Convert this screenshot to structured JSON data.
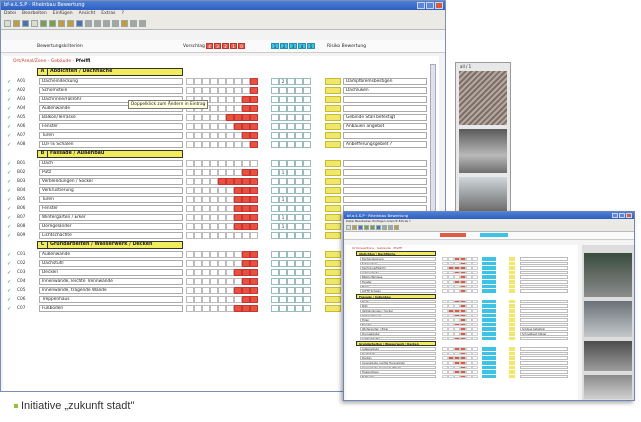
{
  "window": {
    "title": "bf-a.Ł.S.P · Rheinbau Bewertung",
    "menu": [
      "Datei",
      "Bearbeiten",
      "Einfügen",
      "Ansicht",
      "Extras",
      "?"
    ]
  },
  "scale": {
    "left_label": "Bewertungskriterien",
    "mid_label": "Vorschlag",
    "red_values": [
      "4",
      "3",
      "2",
      "1",
      "0"
    ],
    "blue_values": [
      "1",
      "2",
      "3",
      "4",
      "5"
    ],
    "right_label": "Risiko Bewertung"
  },
  "grid": {
    "breadcrumb_pre": "Ort/Areal/Zone - Gebäude - ",
    "breadcrumb_cur": "Pfeiffl",
    "tooltip": "Doppelklick zum Ändern in Eintrag",
    "photo_label": "all / 1"
  },
  "sections": [
    {
      "num": "A",
      "title": "Abdichten / Dachfläche",
      "rows": [
        {
          "code": "A01",
          "name": "Dacheindeckung",
          "red": [
            5
          ],
          "blue": "2",
          "note": "Dampfbremsbestigen"
        },
        {
          "code": "A02",
          "name": "Schornstein",
          "red": [
            5
          ],
          "blue": "",
          "note": "Dachluken"
        },
        {
          "code": "A03",
          "name": "Dachrinne/Fallrohr",
          "red": [
            4,
            5
          ],
          "blue": "",
          "note": ""
        },
        {
          "code": "A04",
          "name": "Außenwände",
          "red": [
            4,
            5
          ],
          "blue": "",
          "note": ""
        },
        {
          "code": "A05",
          "name": "Balkon/Terrasse",
          "red": [
            2,
            3,
            4,
            5
          ],
          "blue": "",
          "note": "Gebinde Stall befestigt"
        },
        {
          "code": "A06",
          "name": "Fenster",
          "red": [
            3,
            4,
            5
          ],
          "blue": "",
          "note": "Anbauen angebot"
        },
        {
          "code": "A07",
          "name": "Türen",
          "red": [
            4,
            5
          ],
          "blue": "",
          "note": ""
        },
        {
          "code": "A08",
          "name": "LÜFTE Schalen",
          "red": [
            5
          ],
          "blue": "",
          "note": "Anbefferungsgebiet ?"
        }
      ]
    },
    {
      "num": "B",
      "title": "Fassade / Außenbau",
      "rows": [
        {
          "code": "B01",
          "name": "Dach",
          "red": [],
          "blue": "",
          "note": ""
        },
        {
          "code": "B02",
          "name": "Putz",
          "red": [
            4,
            5
          ],
          "blue": "1",
          "note": ""
        },
        {
          "code": "B03",
          "name": "Verblendungen / Sockel",
          "red": [
            1,
            2,
            3,
            4,
            5
          ],
          "blue": "",
          "note": ""
        },
        {
          "code": "B04",
          "name": "Verkrustierung",
          "red": [
            3,
            4,
            5
          ],
          "blue": "",
          "note": ""
        },
        {
          "code": "B05",
          "name": "Türen",
          "red": [
            3,
            4,
            5
          ],
          "blue": "1",
          "note": ""
        },
        {
          "code": "B06",
          "name": "Fenster",
          "red": [
            3,
            4,
            5
          ],
          "blue": "",
          "note": ""
        },
        {
          "code": "B07",
          "name": "Wintergarten / Erker",
          "red": [
            3,
            4,
            5
          ],
          "blue": "1",
          "note": ""
        },
        {
          "code": "B08",
          "name": "Dorngeländer",
          "red": [
            3,
            4,
            5
          ],
          "blue": "1",
          "note": ""
        },
        {
          "code": "B09",
          "name": "Lichtschächte",
          "red": [],
          "blue": "",
          "note": ""
        }
      ]
    },
    {
      "num": "C",
      "title": "Grundarbeiten / Wasserwerk / Decken",
      "rows": [
        {
          "code": "C01",
          "name": "Außenwände",
          "red": [
            4,
            5
          ],
          "blue": "",
          "note": ""
        },
        {
          "code": "C02",
          "name": "Dachstuhl",
          "red": [
            4,
            5
          ],
          "blue": "",
          "note": ""
        },
        {
          "code": "C03",
          "name": "Decken",
          "red": [
            3,
            4,
            5
          ],
          "blue": "",
          "note": ""
        },
        {
          "code": "C04",
          "name": "Innenwände, leichte Trennwände",
          "red": [
            4,
            5
          ],
          "blue": "",
          "note": ""
        },
        {
          "code": "C05",
          "name": "Innenwände, tragende Wände",
          "red": [
            3,
            4,
            5
          ],
          "blue": "",
          "note": ""
        },
        {
          "code": "C06",
          "name": "Treppenhaus",
          "red": [
            4,
            5
          ],
          "blue": "",
          "note": ""
        },
        {
          "code": "C07",
          "name": "Fußboden",
          "red": [
            3,
            4,
            5
          ],
          "blue": "",
          "note": ""
        }
      ]
    }
  ],
  "window2": {
    "title": "bf-a.Ł.S.P · Rheinbau Bewertung",
    "menu": "Datei  Bearbeiten  Einfügen  Ansicht  Extras  ?",
    "breadcrumb": "Ort/Areal/Zone · Gebäude · Pfeiffl",
    "sections": [
      "Abdichten / Dachfläche",
      "Fassade / Außenbau",
      "Grundarbeiten / Wasserwerk / Decken"
    ],
    "notes": [
      "Schlaug befestigt",
      "Schnellbaut Kläger"
    ]
  },
  "caption": "Initiative „zukunft stadt\""
}
